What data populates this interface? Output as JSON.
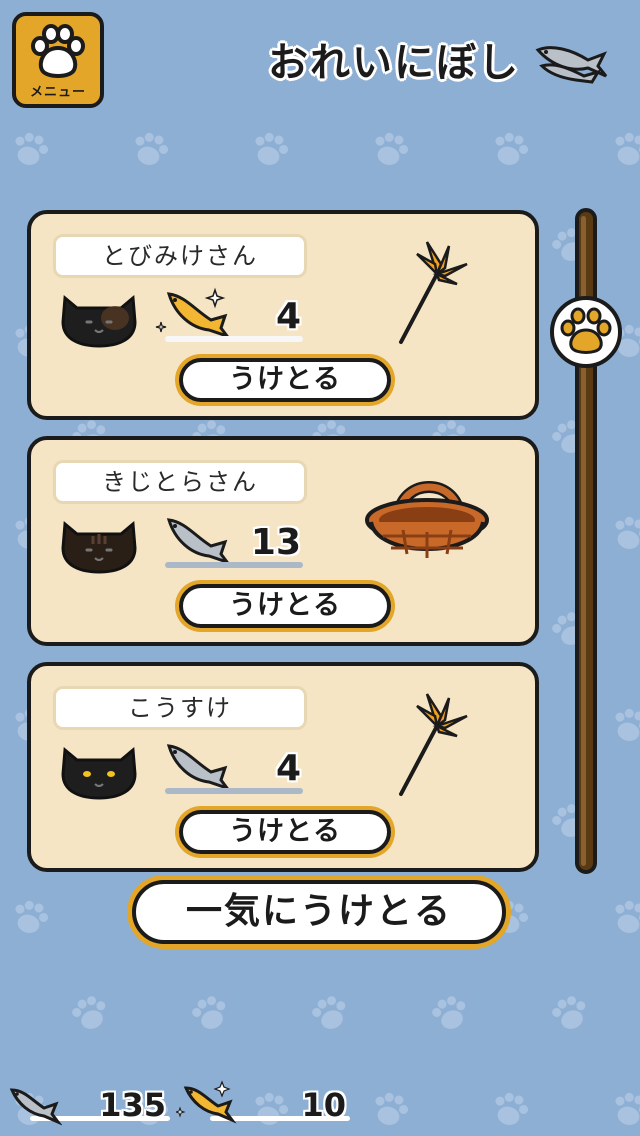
{
  "colors": {
    "background": "#8eafd4",
    "paw_pattern": "#a8c2e0",
    "card": "#f5e5c4",
    "accent_gold": "#e3a628",
    "outline": "#1b1b1b",
    "silver_underline": "#aab8c8",
    "gold_underline": "#f0f0f0"
  },
  "menu": {
    "label": "メニュー",
    "icon": "paw-icon"
  },
  "title": "おれいにぼし",
  "cards": [
    {
      "name": "とびみけさん",
      "cat_icon": "black-cat-icon",
      "fish_type": "gold-fish-icon",
      "count": "4",
      "gift_icon": "cat-teaser-wand-icon",
      "button_label": "うけとる"
    },
    {
      "name": "きじとらさん",
      "cat_icon": "dark-tabby-cat-icon",
      "fish_type": "silver-fish-icon",
      "count": "13",
      "gift_icon": "wicker-basket-icon",
      "button_label": "うけとる"
    },
    {
      "name": "こうすけ",
      "cat_icon": "black-cat-yellow-eyes-icon",
      "fish_type": "silver-fish-icon",
      "count": "4",
      "gift_icon": "cat-teaser-wand-icon",
      "button_label": "うけとる"
    }
  ],
  "receive_all_label": "一気にうけとる",
  "footer": {
    "silver_fish_count": "135",
    "gold_fish_count": "10"
  }
}
